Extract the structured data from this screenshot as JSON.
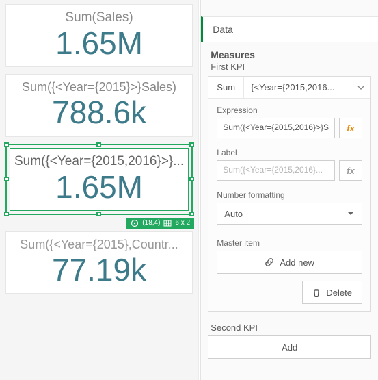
{
  "canvas": {
    "cards": [
      {
        "label": "Sum(Sales)",
        "value": "1.65M"
      },
      {
        "label": "Sum({<Year={2015}>}Sales)",
        "value": "788.6k"
      },
      {
        "label": "Sum({<Year={2015,2016}>}...",
        "value": "1.65M"
      },
      {
        "label": "Sum({<Year={2015},Countr...",
        "value": "77.19k"
      }
    ],
    "selection_badge": {
      "pos": "(18,4)",
      "size": "6 x 2"
    }
  },
  "panel": {
    "accordion": "Data",
    "measures_title": "Measures",
    "first_kpi_label": "First KPI",
    "measure_head": {
      "agg": "Sum",
      "expr": "{<Year={2015,2016..."
    },
    "expression": {
      "label": "Expression",
      "value": "Sum({<Year={2015,2016}>}S"
    },
    "label_field": {
      "label": "Label",
      "placeholder": "Sum({<Year={2015,2016}..."
    },
    "number_format": {
      "label": "Number formatting",
      "value": "Auto"
    },
    "master_item": {
      "label": "Master item",
      "add_new": "Add new",
      "delete": "Delete"
    },
    "second_kpi": {
      "label": "Second KPI",
      "add": "Add"
    }
  }
}
